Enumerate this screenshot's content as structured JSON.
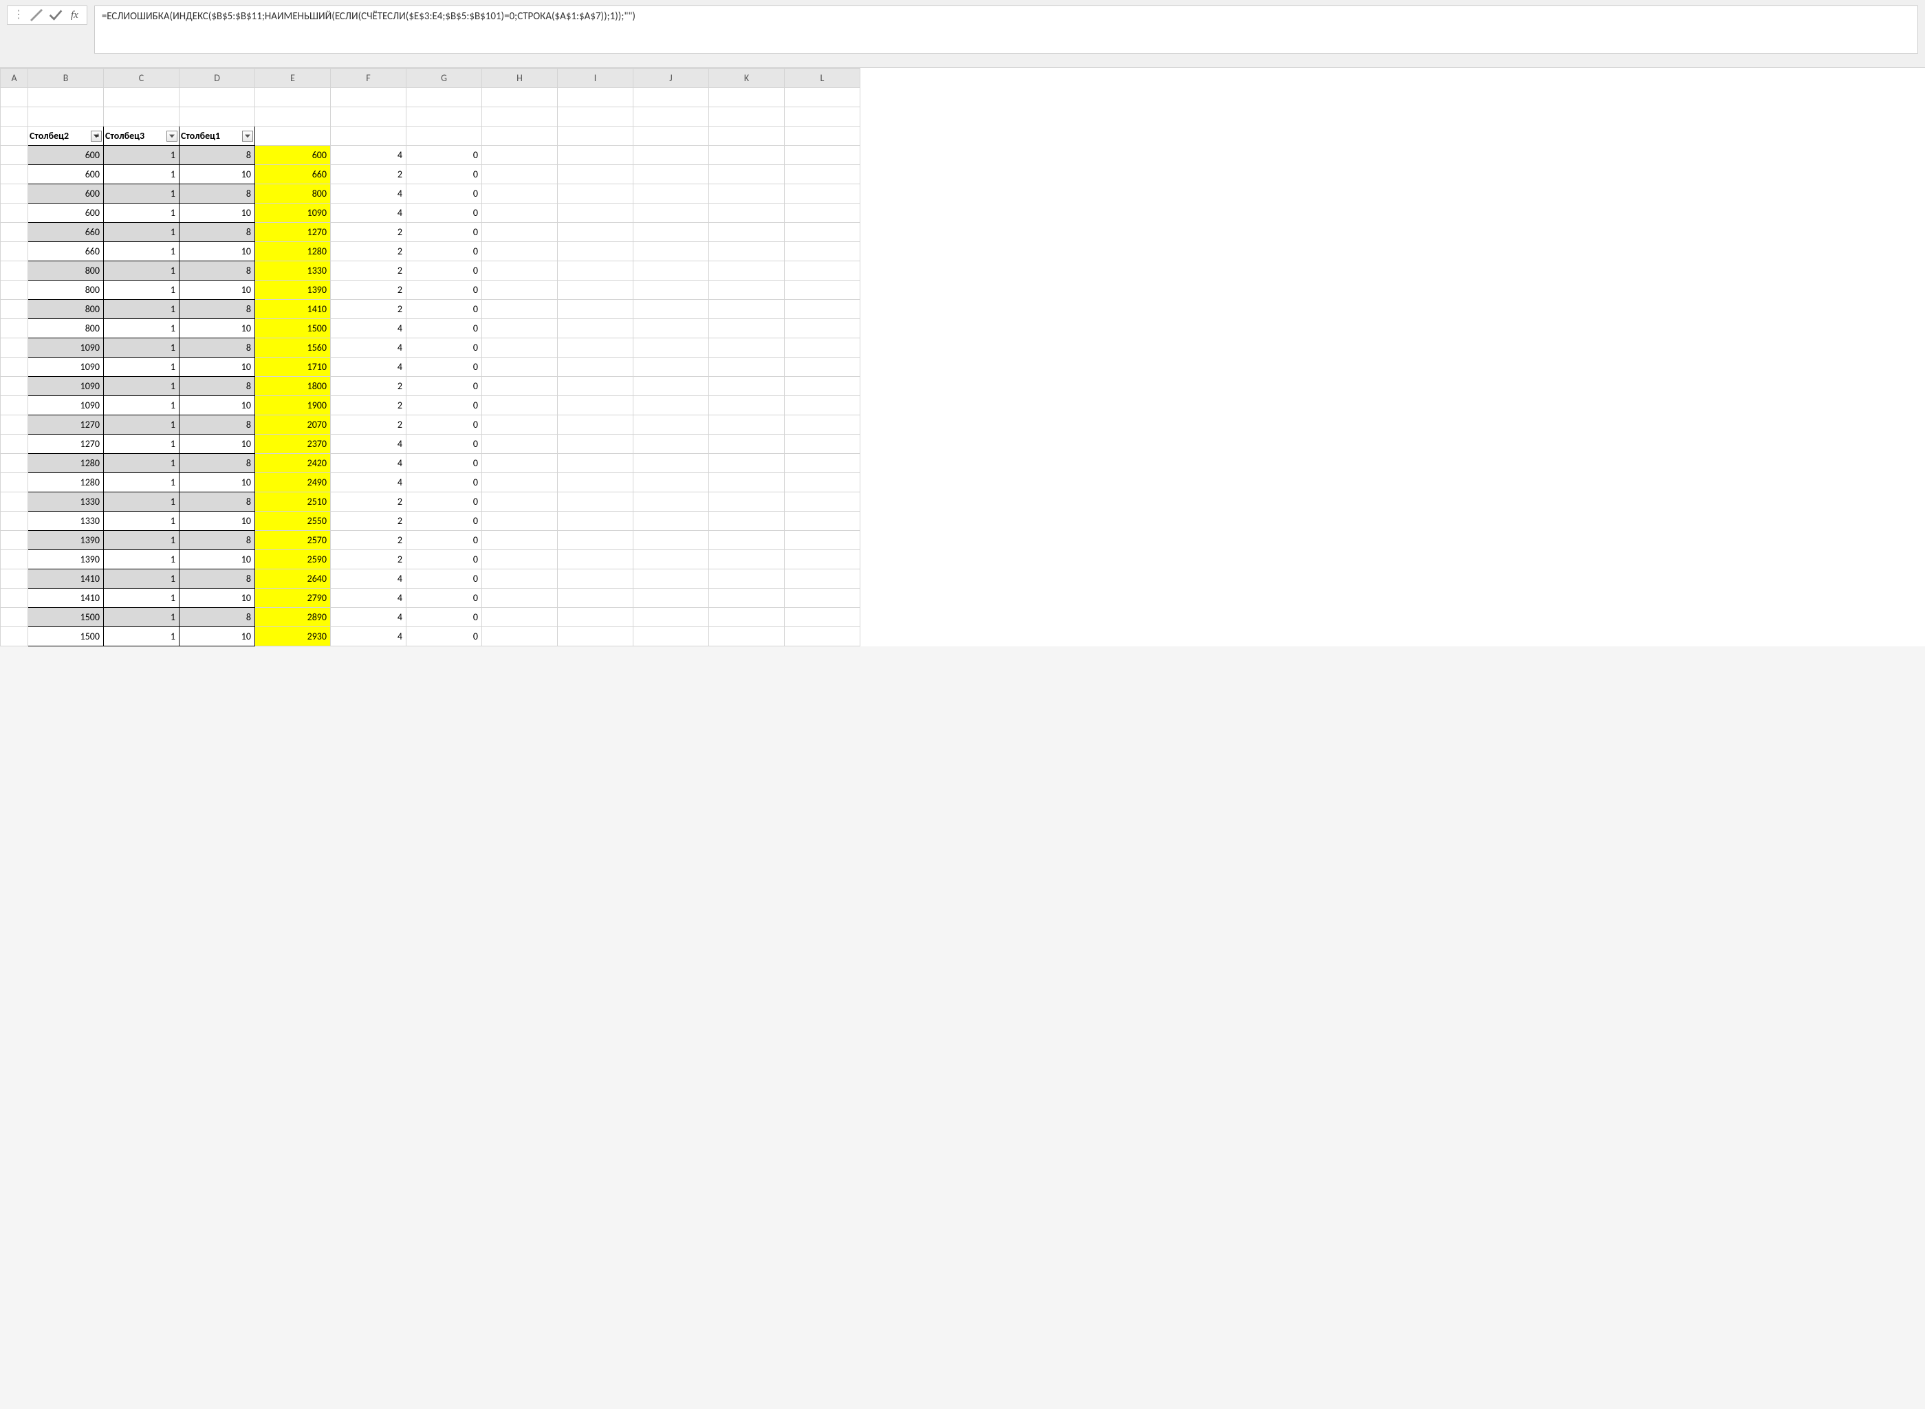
{
  "formula_bar": {
    "formula": "=ЕСЛИОШИБКА(ИНДЕКС($B$5:$B$11;НАИМЕНЬШИЙ(ЕСЛИ(СЧЁТЕСЛИ($E$3:E4;$B$5:$B$101)=0;СТРОКА($A$1:$A$7));1));\"\")",
    "fx_label": "fx"
  },
  "columns": [
    "A",
    "B",
    "C",
    "D",
    "E",
    "F",
    "G",
    "H",
    "I",
    "J",
    "K",
    "L"
  ],
  "table_headers": {
    "b": "Столбец2",
    "c": "Столбец3",
    "d": "Столбец1"
  },
  "rows": [
    {
      "b": "600",
      "c": "1",
      "d": "8",
      "e": "600",
      "f": "4",
      "g": "0"
    },
    {
      "b": "600",
      "c": "1",
      "d": "10",
      "e": "660",
      "f": "2",
      "g": "0"
    },
    {
      "b": "600",
      "c": "1",
      "d": "8",
      "e": "800",
      "f": "4",
      "g": "0"
    },
    {
      "b": "600",
      "c": "1",
      "d": "10",
      "e": "1090",
      "f": "4",
      "g": "0"
    },
    {
      "b": "660",
      "c": "1",
      "d": "8",
      "e": "1270",
      "f": "2",
      "g": "0"
    },
    {
      "b": "660",
      "c": "1",
      "d": "10",
      "e": "1280",
      "f": "2",
      "g": "0"
    },
    {
      "b": "800",
      "c": "1",
      "d": "8",
      "e": "1330",
      "f": "2",
      "g": "0"
    },
    {
      "b": "800",
      "c": "1",
      "d": "10",
      "e": "1390",
      "f": "2",
      "g": "0"
    },
    {
      "b": "800",
      "c": "1",
      "d": "8",
      "e": "1410",
      "f": "2",
      "g": "0"
    },
    {
      "b": "800",
      "c": "1",
      "d": "10",
      "e": "1500",
      "f": "4",
      "g": "0"
    },
    {
      "b": "1090",
      "c": "1",
      "d": "8",
      "e": "1560",
      "f": "4",
      "g": "0"
    },
    {
      "b": "1090",
      "c": "1",
      "d": "10",
      "e": "1710",
      "f": "4",
      "g": "0"
    },
    {
      "b": "1090",
      "c": "1",
      "d": "8",
      "e": "1800",
      "f": "2",
      "g": "0"
    },
    {
      "b": "1090",
      "c": "1",
      "d": "10",
      "e": "1900",
      "f": "2",
      "g": "0"
    },
    {
      "b": "1270",
      "c": "1",
      "d": "8",
      "e": "2070",
      "f": "2",
      "g": "0"
    },
    {
      "b": "1270",
      "c": "1",
      "d": "10",
      "e": "2370",
      "f": "4",
      "g": "0"
    },
    {
      "b": "1280",
      "c": "1",
      "d": "8",
      "e": "2420",
      "f": "4",
      "g": "0"
    },
    {
      "b": "1280",
      "c": "1",
      "d": "10",
      "e": "2490",
      "f": "4",
      "g": "0"
    },
    {
      "b": "1330",
      "c": "1",
      "d": "8",
      "e": "2510",
      "f": "2",
      "g": "0"
    },
    {
      "b": "1330",
      "c": "1",
      "d": "10",
      "e": "2550",
      "f": "2",
      "g": "0"
    },
    {
      "b": "1390",
      "c": "1",
      "d": "8",
      "e": "2570",
      "f": "2",
      "g": "0"
    },
    {
      "b": "1390",
      "c": "1",
      "d": "10",
      "e": "2590",
      "f": "2",
      "g": "0"
    },
    {
      "b": "1410",
      "c": "1",
      "d": "8",
      "e": "2640",
      "f": "4",
      "g": "0"
    },
    {
      "b": "1410",
      "c": "1",
      "d": "10",
      "e": "2790",
      "f": "4",
      "g": "0"
    },
    {
      "b": "1500",
      "c": "1",
      "d": "8",
      "e": "2890",
      "f": "4",
      "g": "0"
    },
    {
      "b": "1500",
      "c": "1",
      "d": "10",
      "e": "2930",
      "f": "4",
      "g": "0"
    }
  ]
}
